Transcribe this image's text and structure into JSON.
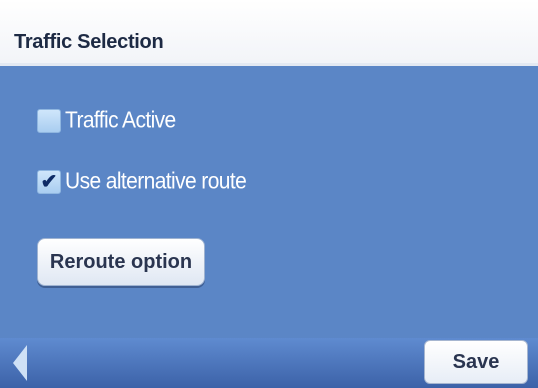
{
  "header": {
    "title": "Traffic Selection"
  },
  "options": [
    {
      "label": "Traffic Active",
      "checked": false
    },
    {
      "label": "Use alternative route",
      "checked": true
    }
  ],
  "checkmark_glyph": "✔",
  "reroute": {
    "label": "Reroute option"
  },
  "footer": {
    "back_icon": "back-arrow-icon",
    "save_label": "Save"
  },
  "colors": {
    "background": "#5b86c6",
    "header": "#ffffff",
    "footer": "#3c62a8"
  }
}
